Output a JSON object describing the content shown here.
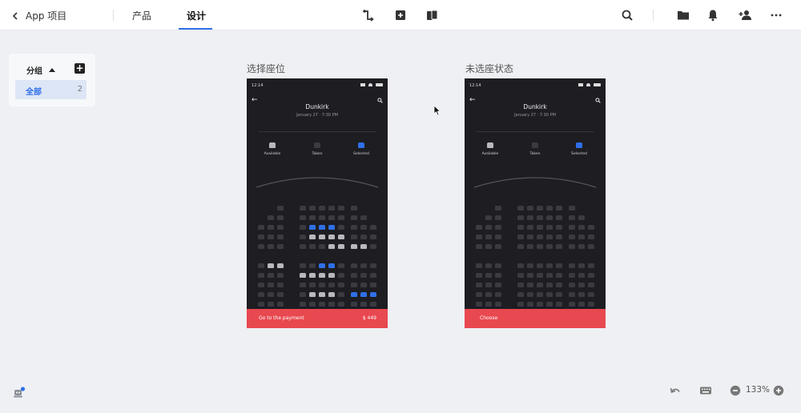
{
  "nav": {
    "back_label": "App 项目",
    "tabs": [
      {
        "label": "产品"
      },
      {
        "label": "设计"
      }
    ]
  },
  "sidebar": {
    "title": "分组",
    "items": [
      {
        "label": "全部",
        "count": "2"
      }
    ]
  },
  "artboards": [
    {
      "title": "选择座位",
      "phone": {
        "time": "12:14",
        "movie": "Dunkirk",
        "showtime": "January 27 · 7:30 PM",
        "legend": [
          {
            "label": "Available"
          },
          {
            "label": "Taken"
          },
          {
            "label": "Selected"
          }
        ],
        "cta_label": "Go to the payment",
        "cta_price": "$ 449"
      }
    },
    {
      "title": "未选座状态",
      "phone": {
        "time": "12:14",
        "movie": "Dunkirk",
        "showtime": "January 27 · 7:30 PM",
        "legend": [
          {
            "label": "Available"
          },
          {
            "label": "Taken"
          },
          {
            "label": "Selected"
          }
        ],
        "cta_label": "Choose"
      }
    }
  ],
  "zoom": {
    "level": "133%"
  },
  "colors": {
    "accent": "#2f6fe8",
    "seat_available": "#b8b8bf",
    "seat_taken": "#3a3a41",
    "seat_selected": "#2f6fe8",
    "cta": "#e8484f",
    "phone_bg": "#1d1d22"
  }
}
